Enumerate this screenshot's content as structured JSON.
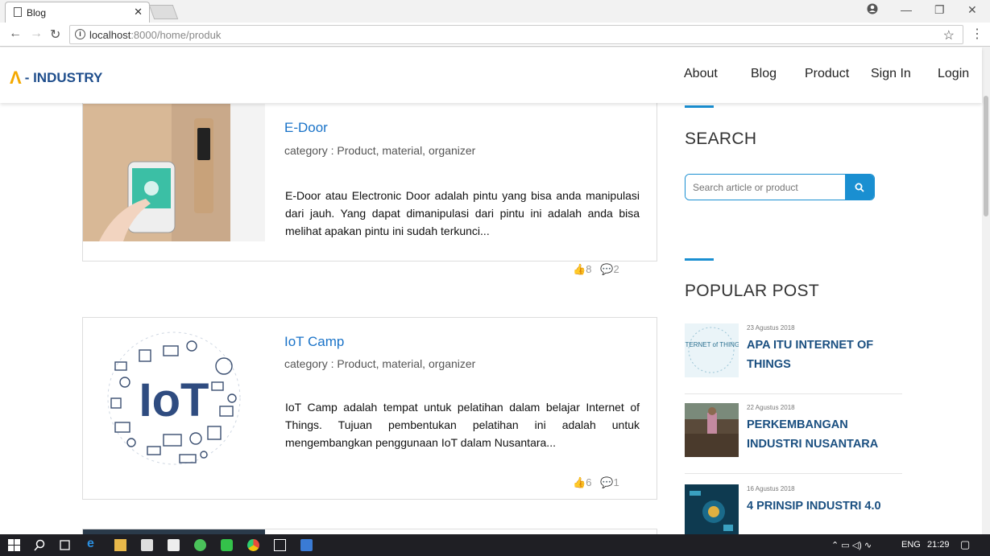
{
  "browser": {
    "tab_title": "Blog",
    "url_host": "localhost",
    "url_rest": ":8000/home/produk"
  },
  "site": {
    "logo_text": "- INDUSTRY",
    "logo_mark": "Λ",
    "nav": [
      "About",
      "Blog",
      "Product",
      "Sign In",
      "Login"
    ]
  },
  "posts": [
    {
      "title": "E-Door",
      "category": "category : Product, material, organizer",
      "description": "E-Door atau Electronic Door adalah pintu yang bisa anda manipulasi dari jauh. Yang dapat dimanipulasi dari pintu ini adalah anda bisa melihat apakan pintu ini sudah terkunci...",
      "likes": "8",
      "comments": "2"
    },
    {
      "title": "IoT Camp",
      "category": "category : Product, material, organizer",
      "description": "IoT Camp adalah tempat untuk pelatihan dalam belajar Internet of Things. Tujuan pembentukan pelatihan ini adalah untuk mengembangkan penggunaan IoT dalam Nusantara...",
      "likes": "6",
      "comments": "1"
    }
  ],
  "sidebar": {
    "search_heading": "SEARCH",
    "search_placeholder": "Search article or product",
    "popular_heading": "POPULAR POST",
    "popular": [
      {
        "date": "23 Agustus 2018",
        "title": "APA ITU INTERNET OF THINGS",
        "img_text": "INTERNET of THINGS"
      },
      {
        "date": "22 Agustus 2018",
        "title": "PERKEMBANGAN INDUSTRI NUSANTARA",
        "img_text": ""
      },
      {
        "date": "16 Agustus 2018",
        "title": "4 PRINSIP INDUSTRI 4.0",
        "img_text": ""
      }
    ]
  },
  "taskbar": {
    "lang": "ENG",
    "time": "21:29"
  },
  "colors": {
    "accent": "#1a8fd1",
    "title_blue": "#1a73c8",
    "logo_blue": "#1f4e8c",
    "logo_orange": "#f4a900"
  }
}
